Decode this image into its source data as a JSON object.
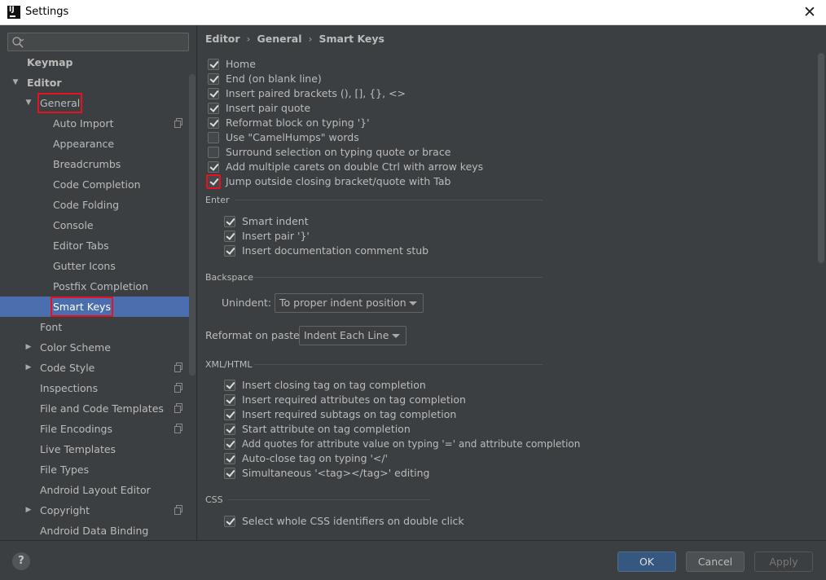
{
  "window": {
    "title": "Settings",
    "app_icon_text": "IJ"
  },
  "search": {
    "placeholder": ""
  },
  "sidebar": {
    "items": [
      {
        "label": "Keymap"
      },
      {
        "label": "Editor"
      },
      {
        "label": "General"
      },
      {
        "label": "Auto Import"
      },
      {
        "label": "Appearance"
      },
      {
        "label": "Breadcrumbs"
      },
      {
        "label": "Code Completion"
      },
      {
        "label": "Code Folding"
      },
      {
        "label": "Console"
      },
      {
        "label": "Editor Tabs"
      },
      {
        "label": "Gutter Icons"
      },
      {
        "label": "Postfix Completion"
      },
      {
        "label": "Smart Keys"
      },
      {
        "label": "Font"
      },
      {
        "label": "Color Scheme"
      },
      {
        "label": "Code Style"
      },
      {
        "label": "Inspections"
      },
      {
        "label": "File and Code Templates"
      },
      {
        "label": "File Encodings"
      },
      {
        "label": "Live Templates"
      },
      {
        "label": "File Types"
      },
      {
        "label": "Android Layout Editor"
      },
      {
        "label": "Copyright"
      },
      {
        "label": "Android Data Binding"
      }
    ]
  },
  "breadcrumb": [
    "Editor",
    "General",
    "Smart Keys"
  ],
  "options": [
    {
      "label": "Home",
      "checked": true
    },
    {
      "label": "End (on blank line)",
      "checked": true
    },
    {
      "label": "Insert paired brackets (), [], {}, <>",
      "checked": true
    },
    {
      "label": "Insert pair quote",
      "checked": true
    },
    {
      "label": "Reformat block on typing '}'",
      "checked": true
    },
    {
      "label": "Use \"CamelHumps\" words",
      "checked": false
    },
    {
      "label": "Surround selection on typing quote or brace",
      "checked": false
    },
    {
      "label": "Add multiple carets on double Ctrl with arrow keys",
      "checked": true
    },
    {
      "label": "Jump outside closing bracket/quote with Tab",
      "checked": true
    }
  ],
  "enter": {
    "title": "Enter",
    "options": [
      {
        "label": "Smart indent",
        "checked": true
      },
      {
        "label": "Insert pair '}'",
        "checked": true
      },
      {
        "label": "Insert documentation comment stub",
        "checked": true
      }
    ]
  },
  "backspace": {
    "title": "Backspace",
    "unindent_label": "Unindent:",
    "unindent_value": "To proper indent position",
    "reformat_label": "Reformat on paste:",
    "reformat_value": "Indent Each Line"
  },
  "xml": {
    "title": "XML/HTML",
    "options": [
      {
        "label": "Insert closing tag on tag completion",
        "checked": true
      },
      {
        "label": "Insert required attributes on tag completion",
        "checked": true
      },
      {
        "label": "Insert required subtags on tag completion",
        "checked": true
      },
      {
        "label": "Start attribute on tag completion",
        "checked": true
      },
      {
        "label": "Add quotes for attribute value on typing '=' and attribute completion",
        "checked": true
      },
      {
        "label": "Auto-close tag on typing '</'",
        "checked": true
      },
      {
        "label": "Simultaneous '<tag></tag>' editing",
        "checked": true
      }
    ]
  },
  "css": {
    "title": "CSS",
    "options": [
      {
        "label": "Select whole CSS identifiers on double click",
        "checked": true
      }
    ]
  },
  "footer": {
    "help": "?",
    "ok": "OK",
    "cancel": "Cancel",
    "apply": "Apply"
  },
  "colors": {
    "selection": "#4b6eaf",
    "highlight": "#e81123",
    "ok_button": "#365880"
  }
}
